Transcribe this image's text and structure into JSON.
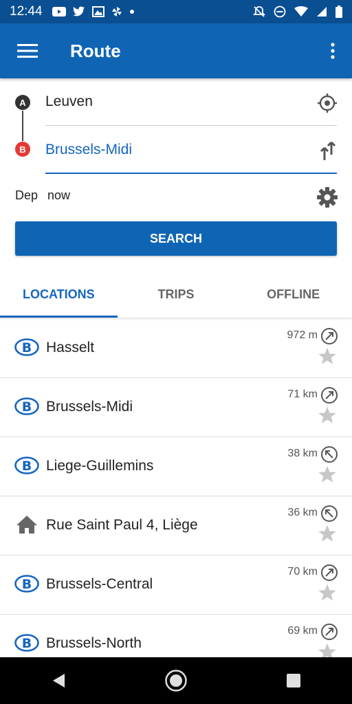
{
  "status": {
    "time": "12:44"
  },
  "appbar": {
    "title": "Route"
  },
  "route": {
    "from_badge": "A",
    "to_badge": "B",
    "from": "Leuven",
    "to": "Brussels-Midi",
    "dep_label": "Dep",
    "dep_value": "now",
    "search_label": "SEARCH"
  },
  "tabs": [
    {
      "label": "LOCATIONS",
      "active": true
    },
    {
      "label": "TRIPS",
      "active": false
    },
    {
      "label": "OFFLINE",
      "active": false
    }
  ],
  "locations": [
    {
      "name": "Hasselt",
      "distance": "972 m",
      "type": "station"
    },
    {
      "name": "Brussels-Midi",
      "distance": "71 km",
      "type": "station"
    },
    {
      "name": "Liege-Guillemins",
      "distance": "38 km",
      "type": "station"
    },
    {
      "name": "Rue Saint Paul 4, Liège",
      "distance": "36 km",
      "type": "address"
    },
    {
      "name": "Brussels-Central",
      "distance": "70 km",
      "type": "station"
    },
    {
      "name": "Brussels-North",
      "distance": "69 km",
      "type": "station"
    }
  ],
  "colors": {
    "primary": "#0f65b4",
    "accent": "#1565c0",
    "status_bar": "#0b4f93",
    "badge_b": "#e53935"
  }
}
